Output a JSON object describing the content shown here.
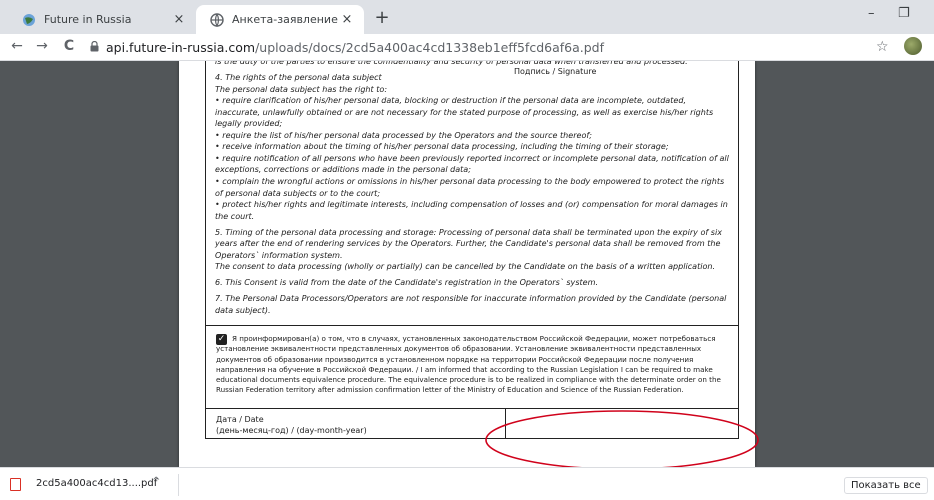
{
  "tabs": [
    {
      "title": "Future in Russia",
      "close": "×"
    },
    {
      "title": "Анкета-заявление / Application",
      "close": "×"
    }
  ],
  "new_tab": "+",
  "window_controls": {
    "minimize": "–",
    "restore": "❐"
  },
  "nav": {
    "back": "←",
    "forward": "→",
    "reload": "C"
  },
  "address_bar": {
    "host": "api.future-in-russia.com",
    "path": "/uploads/docs/2cd5a400ac4cd1338eb1eff5fcd6af6a.pdf"
  },
  "bookmark_star": "☆",
  "consent": {
    "paragraphs": [
      {
        "text": "is the duty of the parties to ensure the confidentiality and security of personal data when transferred and processed.",
        "cont": false
      },
      {
        "text": "4. The rights of the personal data subject",
        "cont": true
      },
      {
        "text": "The personal data subject has the right to:",
        "cont": true
      },
      {
        "text": "• require clarification of his/her personal data, blocking or destruction if the personal data are incomplete, outdated, inaccurate, unlawfully obtained or are not necessary for the stated purpose of processing, as well as exercise his/her rights legally provided;",
        "cont": true
      },
      {
        "text": "• require the list of his/her personal data processed by the Operators and the source thereof;",
        "cont": true
      },
      {
        "text": "• receive information about the timing of his/her personal data processing, including the timing of their storage;",
        "cont": true
      },
      {
        "text": "• require notification of all persons who have been previously reported incorrect or incomplete personal data, notification of all exceptions, corrections or additions made in the personal data;",
        "cont": true
      },
      {
        "text": "• complain the wrongful actions or omissions in his/her personal data processing to the body empowered to protect the rights of personal data subjects or to the court;",
        "cont": true
      },
      {
        "text": "• protect his/her rights and legitimate interests, including compensation of losses and (or) compensation for moral damages in the court.",
        "cont": false
      },
      {
        "text": "5. Timing of the personal data processing and storage: Processing of personal data shall be terminated upon the expiry of six years after the end of rendering services by the Operators. Further, the Candidate's personal data shall be removed from the Operators` information system.",
        "cont": true
      },
      {
        "text": "The consent to data processing (wholly or partially) can be cancelled by the Candidate on the basis of a written application.",
        "cont": false
      },
      {
        "text": "6. This Consent is valid from the date of the Candidate's registration in the Operators` system.",
        "cont": false
      },
      {
        "text": "7. The Personal Data Processors/Operators are not responsible for inaccurate information provided by the Candidate (personal data subject).",
        "cont": false
      }
    ]
  },
  "checkbox": {
    "checked": true,
    "mark": "✓",
    "text": "Я проинформирован(а) о том, что в случаях, установленных законодательством Российской Федерации, может потребоваться установление эквивалентности представленных документов об образовании. Установление эквивалентности представленных документов об образовании производится в установленном порядке на территории Российской Федерации после получения направления на обучение в Российской Федерации. / I am informed that according to the Russian Legislation I can be required to make educational documents equivalence procedure. The equivalence procedure is to be realized in compliance with the determinate order on the Russian Federation territory after admission confirmation letter of the Ministry of Education and Science of the Russian Federation."
  },
  "date_field": {
    "label": "Дата / Date",
    "sublabel": "(день-месяц-год) / (day-month-year)"
  },
  "signature_field": {
    "label": "Подпись / Signature"
  },
  "highlight_color": "#d0021b",
  "download": {
    "file": "2cd5a400ac4cd13....pdf",
    "chevron": "^",
    "icon_glyph": "PDF",
    "show_all": "Показать все"
  }
}
